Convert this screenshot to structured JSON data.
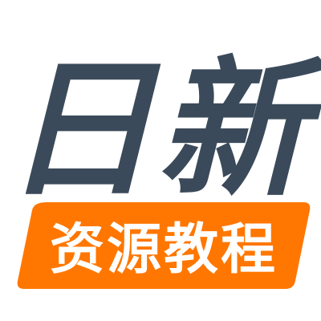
{
  "logo": {
    "title_text": "日新",
    "subtitle_text": "资源教程",
    "colors": {
      "title": "#3b4a5a",
      "badge": "#ff7700",
      "subtitle": "#ffffff",
      "background": "#ffffff"
    }
  }
}
